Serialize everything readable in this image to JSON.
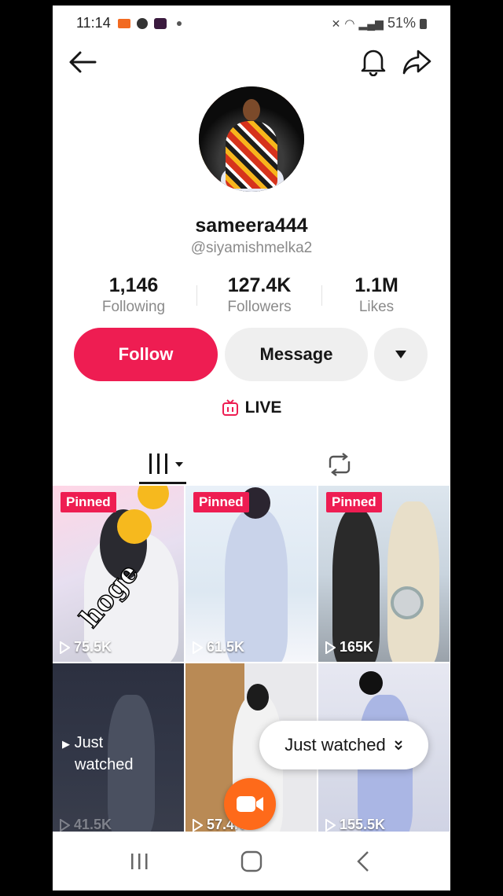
{
  "status_bar": {
    "time": "11:14",
    "battery": "51%"
  },
  "profile": {
    "username": "sameera444",
    "handle": "@siyamishmelka2",
    "stats": [
      {
        "value": "1,146",
        "label": "Following"
      },
      {
        "value": "127.4K",
        "label": "Followers"
      },
      {
        "value": "1.1M",
        "label": "Likes"
      }
    ]
  },
  "actions": {
    "follow": "Follow",
    "message": "Message"
  },
  "live_label": "LIVE",
  "videos": [
    {
      "badge": "Pinned",
      "views": "75.5K",
      "overlay_text": "hoge"
    },
    {
      "badge": "Pinned",
      "views": "61.5K"
    },
    {
      "badge": "Pinned",
      "views": "165K"
    },
    {
      "overlay_label_line1": "Just",
      "overlay_label_line2": "watched",
      "views": "41.5K"
    },
    {
      "views": "57.4K"
    },
    {
      "views": "155.5K"
    }
  ],
  "just_watched_pill": "Just watched",
  "colors": {
    "accent": "#ee1d52",
    "record": "#fe6a1a"
  }
}
